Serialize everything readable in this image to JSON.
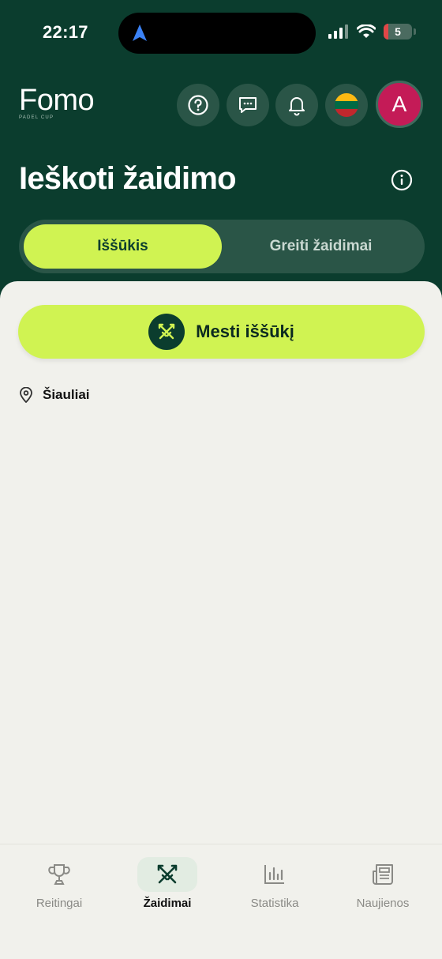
{
  "status_bar": {
    "time": "22:17",
    "battery_level": "5"
  },
  "header": {
    "logo_text": "Fomo",
    "logo_subtext": "PADEL CUP",
    "icons": [
      "help-icon",
      "chat-icon",
      "bell-icon",
      "lithuania-flag-icon"
    ],
    "avatar_letter": "A"
  },
  "page": {
    "title": "Ieškoti žaidimo"
  },
  "segmented": {
    "tabs": [
      {
        "label": "Iššūkis",
        "active": true
      },
      {
        "label": "Greiti žaidimai",
        "active": false
      }
    ]
  },
  "challenge_button": {
    "label": "Mesti iššūkį",
    "icon": "crossed-swords-icon"
  },
  "location": {
    "icon": "location-pin-icon",
    "label": "Šiauliai"
  },
  "tabbar": {
    "items": [
      {
        "label": "Reitingai",
        "icon": "trophy-icon",
        "active": false
      },
      {
        "label": "Žaidimai",
        "icon": "crossed-swords-icon",
        "active": true
      },
      {
        "label": "Statistika",
        "icon": "bar-chart-icon",
        "active": false
      },
      {
        "label": "Naujienos",
        "icon": "newspaper-icon",
        "active": false
      }
    ]
  },
  "colors": {
    "header_bg": "#0b3d2e",
    "accent": "#d0f352",
    "avatar_bg": "#c41b57",
    "page_bg": "#f1f1ec"
  }
}
